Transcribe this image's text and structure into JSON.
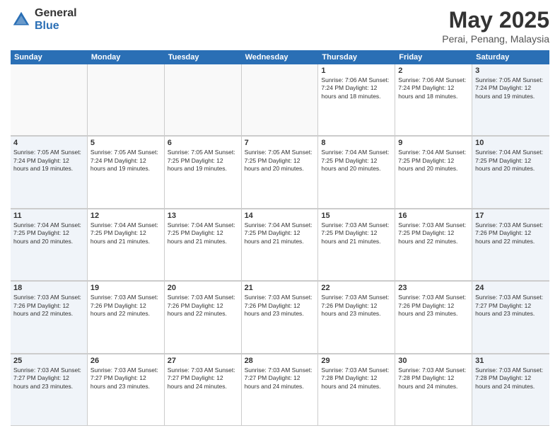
{
  "logo": {
    "general": "General",
    "blue": "Blue"
  },
  "title": {
    "month_year": "May 2025",
    "location": "Perai, Penang, Malaysia"
  },
  "days_of_week": [
    "Sunday",
    "Monday",
    "Tuesday",
    "Wednesday",
    "Thursday",
    "Friday",
    "Saturday"
  ],
  "weeks": [
    [
      {
        "day": "",
        "info": "",
        "empty": true
      },
      {
        "day": "",
        "info": "",
        "empty": true
      },
      {
        "day": "",
        "info": "",
        "empty": true
      },
      {
        "day": "",
        "info": "",
        "empty": true
      },
      {
        "day": "1",
        "info": "Sunrise: 7:06 AM\nSunset: 7:24 PM\nDaylight: 12 hours\nand 18 minutes."
      },
      {
        "day": "2",
        "info": "Sunrise: 7:06 AM\nSunset: 7:24 PM\nDaylight: 12 hours\nand 18 minutes."
      },
      {
        "day": "3",
        "info": "Sunrise: 7:05 AM\nSunset: 7:24 PM\nDaylight: 12 hours\nand 19 minutes.",
        "weekend": true
      }
    ],
    [
      {
        "day": "4",
        "info": "Sunrise: 7:05 AM\nSunset: 7:24 PM\nDaylight: 12 hours\nand 19 minutes.",
        "weekend": true
      },
      {
        "day": "5",
        "info": "Sunrise: 7:05 AM\nSunset: 7:24 PM\nDaylight: 12 hours\nand 19 minutes."
      },
      {
        "day": "6",
        "info": "Sunrise: 7:05 AM\nSunset: 7:25 PM\nDaylight: 12 hours\nand 19 minutes."
      },
      {
        "day": "7",
        "info": "Sunrise: 7:05 AM\nSunset: 7:25 PM\nDaylight: 12 hours\nand 20 minutes."
      },
      {
        "day": "8",
        "info": "Sunrise: 7:04 AM\nSunset: 7:25 PM\nDaylight: 12 hours\nand 20 minutes."
      },
      {
        "day": "9",
        "info": "Sunrise: 7:04 AM\nSunset: 7:25 PM\nDaylight: 12 hours\nand 20 minutes."
      },
      {
        "day": "10",
        "info": "Sunrise: 7:04 AM\nSunset: 7:25 PM\nDaylight: 12 hours\nand 20 minutes.",
        "weekend": true
      }
    ],
    [
      {
        "day": "11",
        "info": "Sunrise: 7:04 AM\nSunset: 7:25 PM\nDaylight: 12 hours\nand 20 minutes.",
        "weekend": true
      },
      {
        "day": "12",
        "info": "Sunrise: 7:04 AM\nSunset: 7:25 PM\nDaylight: 12 hours\nand 21 minutes."
      },
      {
        "day": "13",
        "info": "Sunrise: 7:04 AM\nSunset: 7:25 PM\nDaylight: 12 hours\nand 21 minutes."
      },
      {
        "day": "14",
        "info": "Sunrise: 7:04 AM\nSunset: 7:25 PM\nDaylight: 12 hours\nand 21 minutes."
      },
      {
        "day": "15",
        "info": "Sunrise: 7:03 AM\nSunset: 7:25 PM\nDaylight: 12 hours\nand 21 minutes."
      },
      {
        "day": "16",
        "info": "Sunrise: 7:03 AM\nSunset: 7:25 PM\nDaylight: 12 hours\nand 22 minutes."
      },
      {
        "day": "17",
        "info": "Sunrise: 7:03 AM\nSunset: 7:26 PM\nDaylight: 12 hours\nand 22 minutes.",
        "weekend": true
      }
    ],
    [
      {
        "day": "18",
        "info": "Sunrise: 7:03 AM\nSunset: 7:26 PM\nDaylight: 12 hours\nand 22 minutes.",
        "weekend": true
      },
      {
        "day": "19",
        "info": "Sunrise: 7:03 AM\nSunset: 7:26 PM\nDaylight: 12 hours\nand 22 minutes."
      },
      {
        "day": "20",
        "info": "Sunrise: 7:03 AM\nSunset: 7:26 PM\nDaylight: 12 hours\nand 22 minutes."
      },
      {
        "day": "21",
        "info": "Sunrise: 7:03 AM\nSunset: 7:26 PM\nDaylight: 12 hours\nand 23 minutes."
      },
      {
        "day": "22",
        "info": "Sunrise: 7:03 AM\nSunset: 7:26 PM\nDaylight: 12 hours\nand 23 minutes."
      },
      {
        "day": "23",
        "info": "Sunrise: 7:03 AM\nSunset: 7:26 PM\nDaylight: 12 hours\nand 23 minutes."
      },
      {
        "day": "24",
        "info": "Sunrise: 7:03 AM\nSunset: 7:27 PM\nDaylight: 12 hours\nand 23 minutes.",
        "weekend": true
      }
    ],
    [
      {
        "day": "25",
        "info": "Sunrise: 7:03 AM\nSunset: 7:27 PM\nDaylight: 12 hours\nand 23 minutes.",
        "weekend": true
      },
      {
        "day": "26",
        "info": "Sunrise: 7:03 AM\nSunset: 7:27 PM\nDaylight: 12 hours\nand 23 minutes."
      },
      {
        "day": "27",
        "info": "Sunrise: 7:03 AM\nSunset: 7:27 PM\nDaylight: 12 hours\nand 24 minutes."
      },
      {
        "day": "28",
        "info": "Sunrise: 7:03 AM\nSunset: 7:27 PM\nDaylight: 12 hours\nand 24 minutes."
      },
      {
        "day": "29",
        "info": "Sunrise: 7:03 AM\nSunset: 7:28 PM\nDaylight: 12 hours\nand 24 minutes."
      },
      {
        "day": "30",
        "info": "Sunrise: 7:03 AM\nSunset: 7:28 PM\nDaylight: 12 hours\nand 24 minutes."
      },
      {
        "day": "31",
        "info": "Sunrise: 7:03 AM\nSunset: 7:28 PM\nDaylight: 12 hours\nand 24 minutes.",
        "weekend": true
      }
    ]
  ]
}
